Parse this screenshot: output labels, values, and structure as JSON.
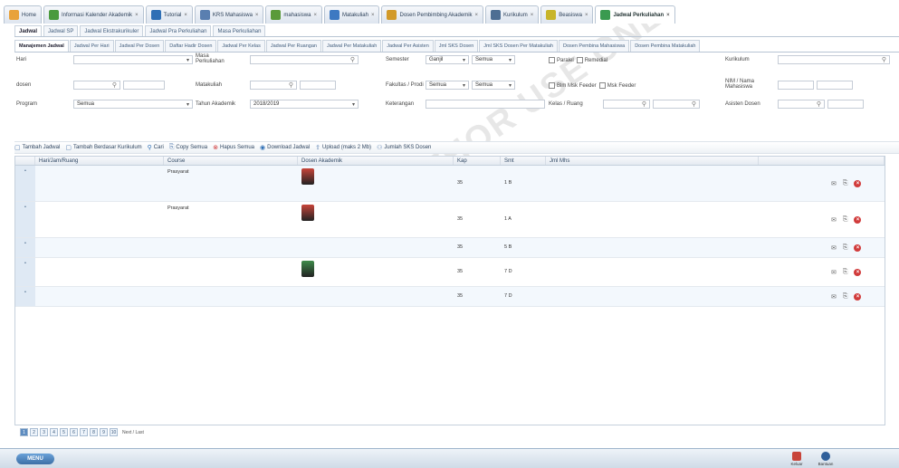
{
  "main_tabs": [
    {
      "label": "Home",
      "icon": "home-icon",
      "color": "#e8a23b"
    },
    {
      "label": "Informasi Kalender Akademik",
      "icon": "calendar-flag-icon",
      "color": "#4a9a3e"
    },
    {
      "label": "Tutorial",
      "icon": "pen-icon",
      "color": "#2f6fb5"
    },
    {
      "label": "KRS Mahasiswa",
      "icon": "user-icon",
      "color": "#5a7fb0"
    },
    {
      "label": "mahasiswa",
      "icon": "users-icon",
      "color": "#5a9a3a"
    },
    {
      "label": "Matakuliah",
      "icon": "book-icon",
      "color": "#3d79c2"
    },
    {
      "label": "Dosen Pembimbing Akademik",
      "icon": "group-icon",
      "color": "#d29a2a"
    },
    {
      "label": "Kurikulum",
      "icon": "grid-icon",
      "color": "#4d6e93"
    },
    {
      "label": "Beasiswa",
      "icon": "award-icon",
      "color": "#c8b52a"
    },
    {
      "label": "Jadwal Perkuliahan",
      "icon": "calendar-icon",
      "color": "#3a9a50"
    }
  ],
  "close_glyph": "×",
  "sub_tabs": [
    "Jadwal",
    "Jadwal SP",
    "Jadwal Ekstrakurikuler",
    "Jadwal Pra Perkuliahan",
    "Masa Perkuliahan"
  ],
  "sub_tabs2": [
    "Manajemen Jadwal",
    "Jadwal Per Hari",
    "Jadwal Per Dosen",
    "Daftar Hadir Dosen",
    "Jadwal Per Kelas",
    "Jadwal Per Ruangan",
    "Jadwal Per Matakuliah",
    "Jadwal Per Asisten",
    "Jml SKS Dosen",
    "Jml SKS Dosen Per Matakuliah",
    "Dosen Pembina Mahasiswa",
    "Dosen Pembina Matakuliah"
  ],
  "form": {
    "hari_label": "Hari",
    "masa_label": "Masa Perkuliahan",
    "semester_label": "Semester",
    "semester_value": "Ganjil",
    "semester_value2": "Semua",
    "paralel_label": "Paralel",
    "remedial_label": "Remedial",
    "kurikulum_label": "Kurikulum",
    "dosen_label": "dosen",
    "matakuliah_label": "Matakuliah",
    "fakultas_label": "Fakultas / Prodi",
    "fakultas_value": "Semua",
    "prodi_value": "Semua",
    "blm_feeder_label": "Blm Msk Feeder",
    "msk_feeder_label": "Msk Feeder",
    "nim_label": "NIM / Nama Mahasiswa",
    "program_label": "Program",
    "program_value": "Semua",
    "tahun_label": "Tahun Akademik",
    "tahun_value": "2018/2019",
    "keterangan_label": "Keterangan",
    "kelas_label": "Kelas / Ruang",
    "asisten_label": "Asisten Dosen"
  },
  "toolbar": [
    {
      "label": "Tambah Jadwal",
      "icon": "add-doc-icon",
      "glyph": "▢",
      "color": "#5a7fb0"
    },
    {
      "label": "Tambah Berdasar Kurikulum",
      "icon": "add-doc-icon",
      "glyph": "▢",
      "color": "#5a7fb0"
    },
    {
      "label": "Cari",
      "icon": "search-icon",
      "glyph": "⚲",
      "color": "#2f6fb5"
    },
    {
      "label": "Copy Semua",
      "icon": "copy-icon",
      "glyph": "⎘",
      "color": "#5a7fb0"
    },
    {
      "label": "Hapus Semua",
      "icon": "delete-icon",
      "glyph": "⊗",
      "color": "#d13b3b"
    },
    {
      "label": "Download Jadwal",
      "icon": "download-icon",
      "glyph": "◉",
      "color": "#2f6fb5"
    },
    {
      "label": "Upload (maks 2 Mb)",
      "icon": "upload-icon",
      "glyph": "⇪",
      "color": "#5a7fb0"
    },
    {
      "label": "Jumlah SKS Dosen",
      "icon": "users-icon",
      "glyph": "⚇",
      "color": "#5a7fb0"
    }
  ],
  "grid": {
    "headers": [
      "",
      "Hari/Jam/Ruang",
      "Course",
      "Dosen Akademik",
      "Kap",
      "Smt",
      "Jml Mhs",
      ""
    ],
    "rows": [
      {
        "time": "",
        "course": "",
        "prasyarat": "Prasyarat",
        "dosen_name": "",
        "photo": "#c8443a",
        "kap": "35",
        "smt": "1 B",
        "status": "",
        "status_red": false
      },
      {
        "time": "",
        "course": "",
        "prasyarat": "Prasyarat",
        "dosen_name": "",
        "photo": "#c8443a",
        "kap": "35",
        "smt": "1 A",
        "status": "",
        "status_red": false
      },
      {
        "time": "",
        "course": "",
        "prasyarat": "",
        "dosen_name": "",
        "photo": "",
        "kap": "35",
        "smt": "5 B",
        "status": "",
        "status_red": true
      },
      {
        "time": "",
        "course": "",
        "prasyarat": "",
        "dosen_name": "",
        "photo": "#3e8a4a",
        "kap": "35",
        "smt": "7 D",
        "status": "",
        "status_red": false
      },
      {
        "time": "",
        "course": "",
        "prasyarat": "",
        "dosen_name": "",
        "photo": "",
        "kap": "35",
        "smt": "7 D",
        "status": "",
        "status_red": true
      }
    ]
  },
  "pager": {
    "pages": [
      "1",
      "2",
      "3",
      "4",
      "5",
      "6",
      "7",
      "8",
      "9",
      "10"
    ],
    "current": "1",
    "next_label": "Next / Last"
  },
  "footer": {
    "menu_label": "MENU",
    "status_line1": "",
    "status_line2": "",
    "icons": [
      {
        "label": "Keluar",
        "icon": "exit-icon",
        "color": "#c8443a"
      },
      {
        "label": "Bantuan",
        "icon": "help-icon",
        "color": "#2f5f9a"
      }
    ]
  },
  "watermark": "FOR AUTHOR USE ONLY"
}
